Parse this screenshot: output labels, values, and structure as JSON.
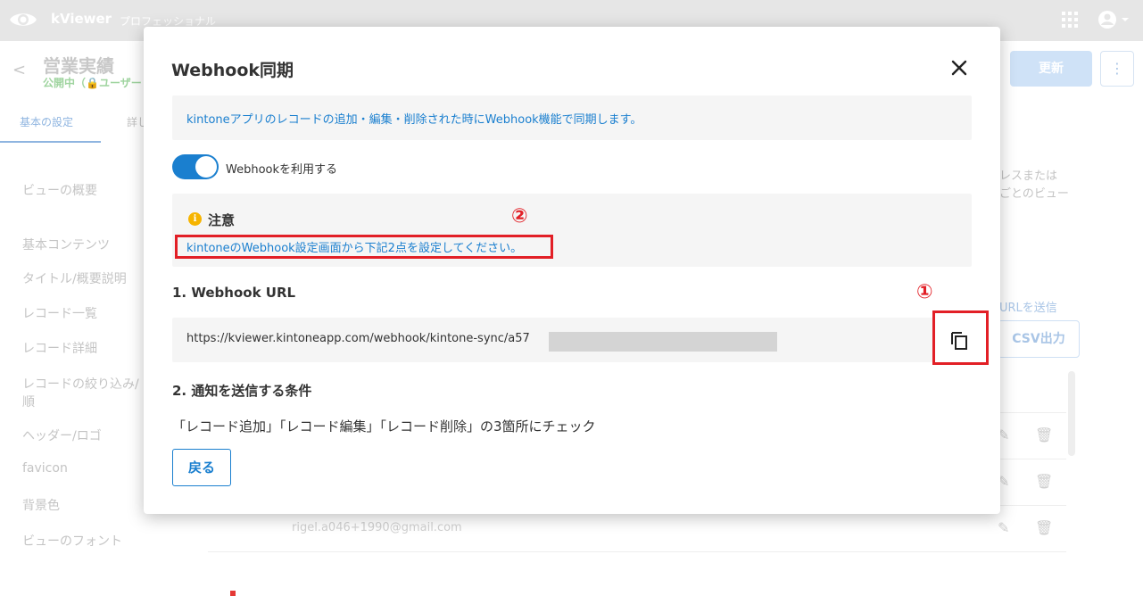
{
  "app": {
    "name": "kViewer",
    "plan": "プロフェッショナル",
    "logo_icon": "eye-icon",
    "apps_icon": "grid-icon",
    "account_icon": "account-circle-icon"
  },
  "view": {
    "back_icon": "chevron-left-icon",
    "title": "営業実績",
    "status": "公開中（🔒ユーザー",
    "update_label": "更新",
    "more_label": "⋮"
  },
  "tabs": [
    {
      "label": "基本の設定"
    },
    {
      "label": "詳し"
    }
  ],
  "sidebar": {
    "items": [
      {
        "label": "ビューの概要"
      },
      {
        "label": "基本コンテンツ"
      },
      {
        "label": "タイトル/概要説明"
      },
      {
        "label": "レコード一覧"
      },
      {
        "label": "レコード詳細"
      },
      {
        "label": "レコードの絞り込み/"
      },
      {
        "label": "順"
      },
      {
        "label": "ヘッダー/ロゴ"
      },
      {
        "label": "favicon"
      },
      {
        "label": "背景色"
      },
      {
        "label": "ビューのフォント"
      }
    ]
  },
  "right_panel": {
    "line1": "レスまたは",
    "line2": "ごとのビュー",
    "send_url": "URLを送信",
    "csv_label": "CSV出力",
    "email": "rigel.a046+1990@gmail.com"
  },
  "modal": {
    "title": "Webhook同期",
    "close_icon": "close-icon",
    "info": "kintoneアプリのレコードの追加・編集・削除された時にWebhook機能で同期します。",
    "toggle_label": "Webhookを利用する",
    "toggle_on": true,
    "warning_title": "注意",
    "warning_icon": "info-icon",
    "warning_text": "kintoneのWebhook設定画面から下記2点を設定してください。",
    "marker_1": "①",
    "marker_2": "②",
    "section1_title": "1. Webhook URL",
    "webhook_url": "https://kviewer.kintoneapp.com/webhook/kintone-sync/a57",
    "copy_icon": "copy-icon",
    "section2_title": "2. 通知を送信する条件",
    "condition_text": "「レコード追加」「レコード編集」「レコード削除」の3箇所にチェック",
    "back_label": "戻る"
  },
  "colors": {
    "accent": "#1a7fcf",
    "highlight_red": "#e21f26",
    "warning": "#f6b400"
  }
}
